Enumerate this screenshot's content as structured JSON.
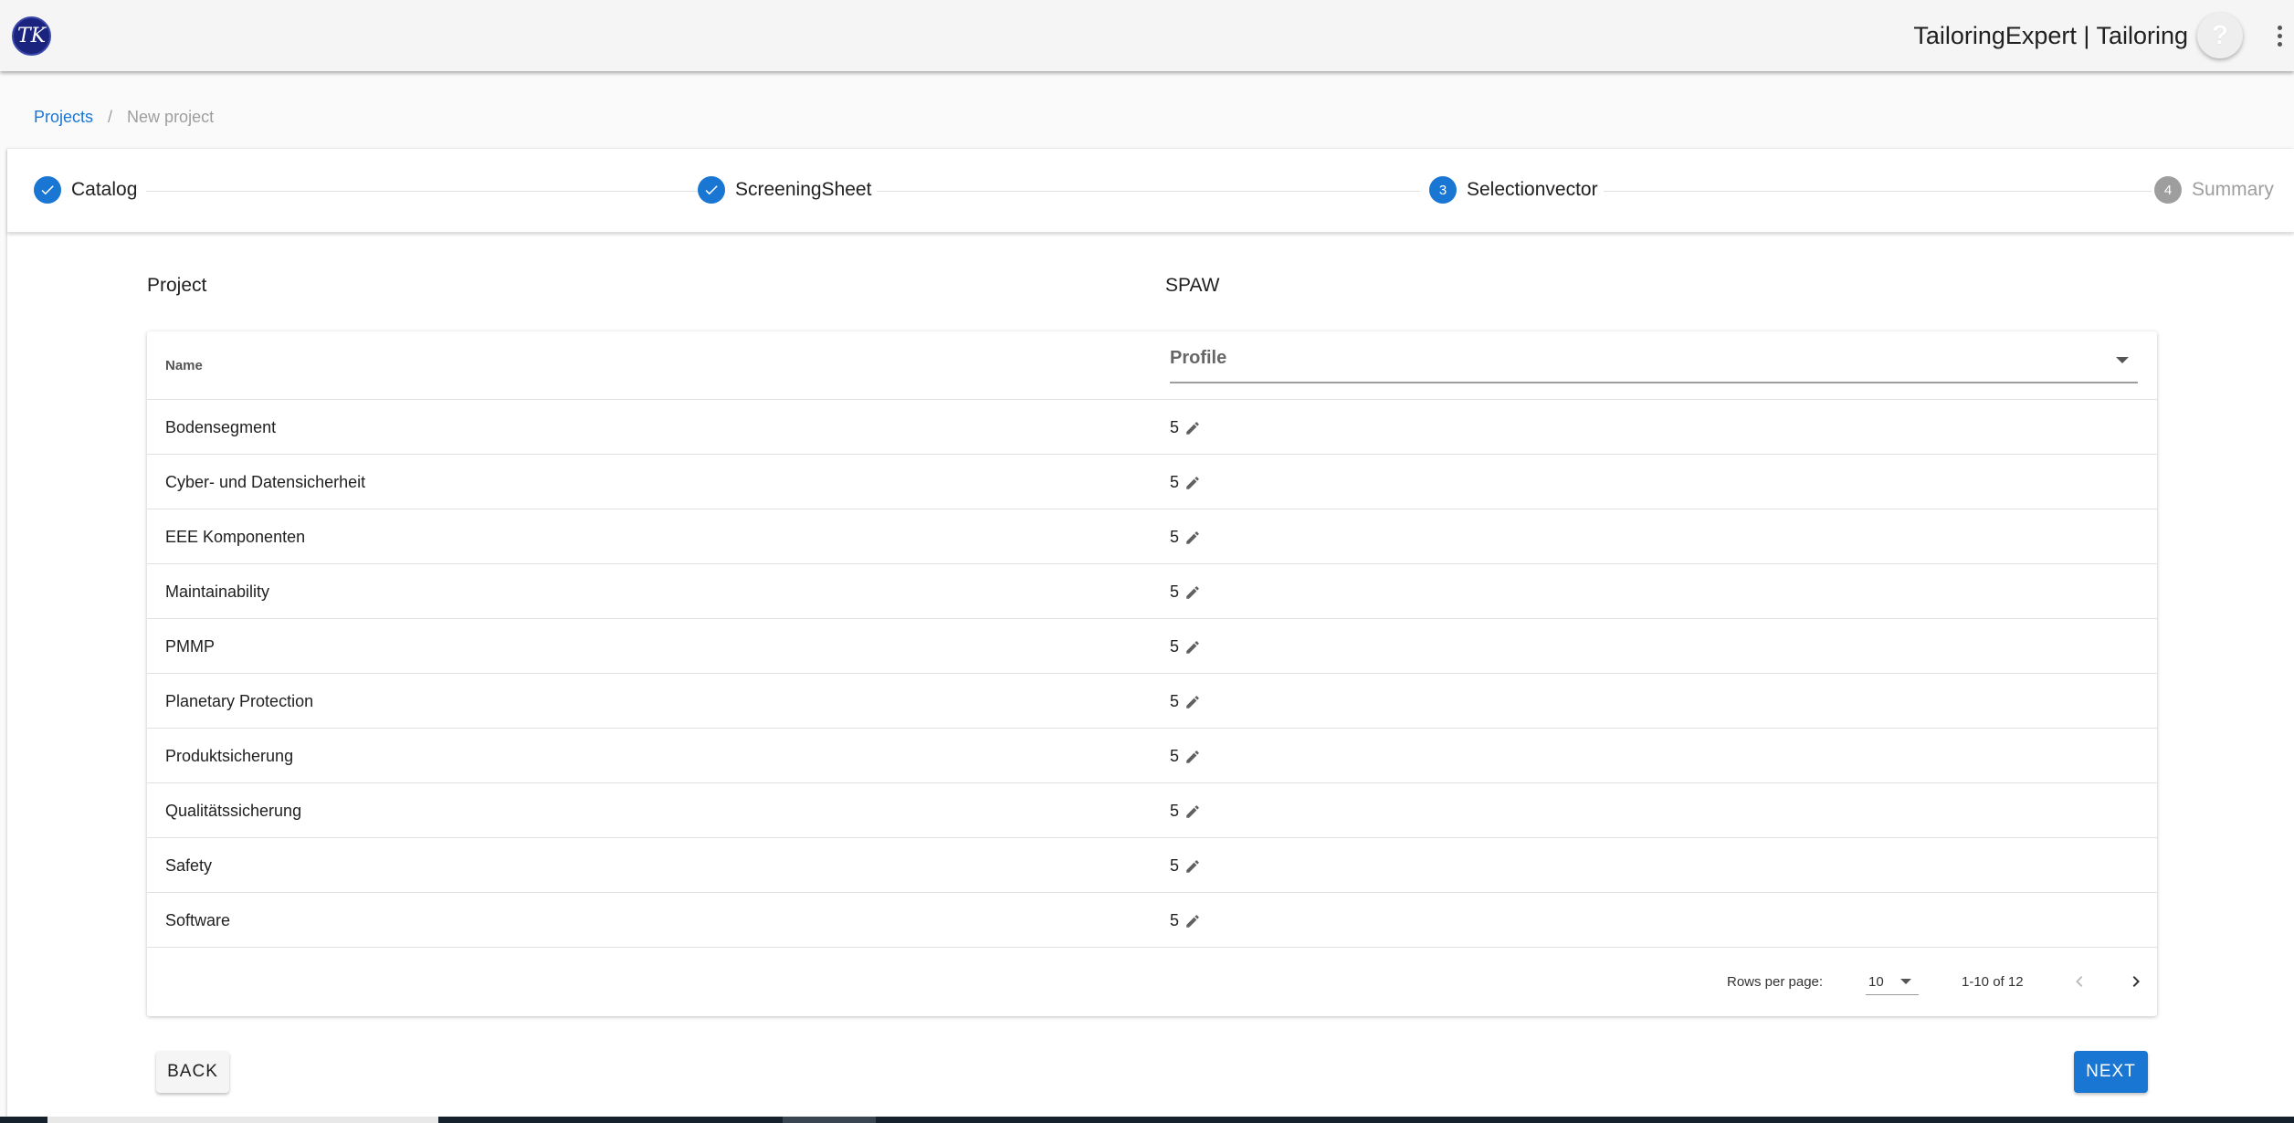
{
  "app": {
    "logo_text": "TK",
    "title": "TailoringExpert | Tailoring",
    "help_glyph": "?",
    "icons": {
      "logo": "tk-logo",
      "help": "help-icon",
      "menu": "more-vert-icon"
    }
  },
  "breadcrumb": {
    "items": [
      "Projects",
      "New project"
    ],
    "separator": "/"
  },
  "stepper": {
    "steps": [
      {
        "label": "Catalog",
        "state": "completed",
        "icon": "check-icon"
      },
      {
        "label": "ScreeningSheet",
        "state": "completed",
        "icon": "check-icon"
      },
      {
        "label": "Selectionvector",
        "state": "active",
        "number": "3"
      },
      {
        "label": "Summary",
        "state": "inactive",
        "number": "4"
      }
    ]
  },
  "project": {
    "label": "Project",
    "value": "SPAW"
  },
  "table": {
    "header": {
      "name": "Name",
      "profile_placeholder": "Profile"
    },
    "rows": [
      {
        "name": "Bodensegment",
        "value": "5"
      },
      {
        "name": "Cyber- und Datensicherheit",
        "value": "5"
      },
      {
        "name": "EEE Komponenten",
        "value": "5"
      },
      {
        "name": "Maintainability",
        "value": "5"
      },
      {
        "name": "PMMP",
        "value": "5"
      },
      {
        "name": "Planetary Protection",
        "value": "5"
      },
      {
        "name": "Produktsicherung",
        "value": "5"
      },
      {
        "name": "Qualitätssicherung",
        "value": "5"
      },
      {
        "name": "Safety",
        "value": "5"
      },
      {
        "name": "Software",
        "value": "5"
      }
    ],
    "pagination": {
      "rows_per_page_label": "Rows per page:",
      "rows_per_page": "10",
      "range": "1-10 of 12",
      "prev_icon": "chevron-left-icon",
      "next_icon": "chevron-right-icon"
    }
  },
  "actions": {
    "back": "BACK",
    "next": "NEXT"
  },
  "colors": {
    "primary": "#1976d2",
    "logo": "#1a237e",
    "inactive": "#9e9e9e"
  }
}
